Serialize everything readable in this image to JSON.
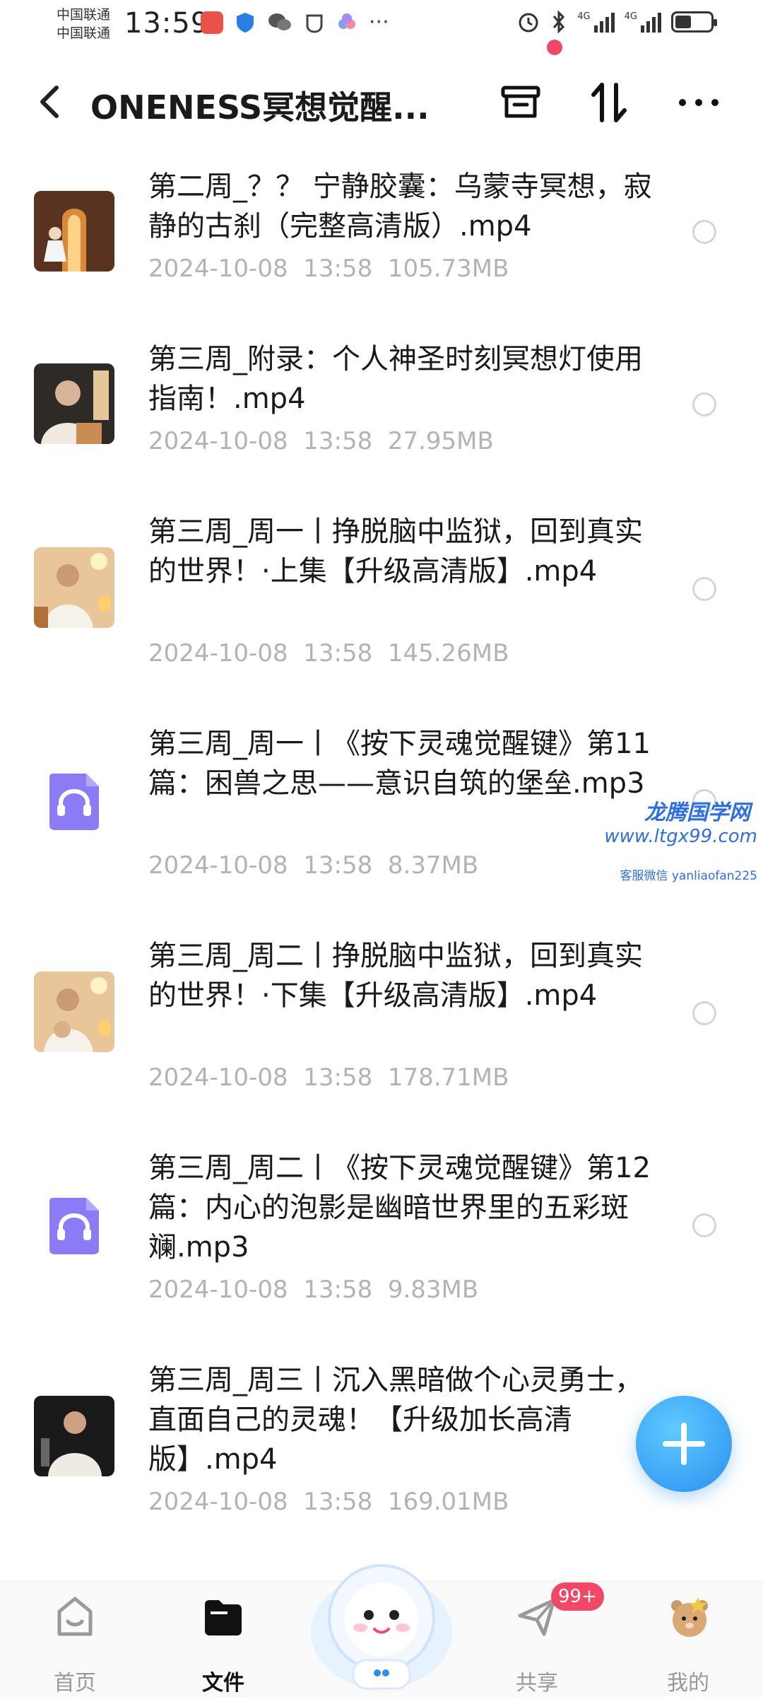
{
  "status_bar": {
    "carrier_1": "中国联通",
    "carrier_2": "中国联通",
    "time": "13:59",
    "more": "···",
    "network_1": "4G",
    "network_2": "4G"
  },
  "header": {
    "title": "ONENESS冥想觉醒...",
    "notification_dot": true
  },
  "files": [
    {
      "title": "第二周_？？ 宁静胶囊：乌蒙寺冥想，寂静的古刹（完整高清版）.mp4",
      "date": "2024-10-08",
      "time": "13:58",
      "size": "105.73MB",
      "type": "video",
      "thumb": "temple"
    },
    {
      "title": "第三周_附录：个人神圣时刻冥想灯使用指南！.mp4",
      "date": "2024-10-08",
      "time": "13:58",
      "size": "27.95MB",
      "type": "video",
      "thumb": "man-lamp"
    },
    {
      "title": "第三周_周一丨挣脱脑中监狱，回到真实的世界！·上集【升级高清版】.mp4",
      "date": "2024-10-08",
      "time": "13:58",
      "size": "145.26MB",
      "type": "video",
      "thumb": "man-candles"
    },
    {
      "title": "第三周_周一丨《按下灵魂觉醒键》第11篇：困兽之思——意识自筑的堡垒.mp3",
      "date": "2024-10-08",
      "time": "13:58",
      "size": "8.37MB",
      "type": "audio",
      "thumb": "headphones"
    },
    {
      "title": "第三周_周二丨挣脱脑中监狱，回到真实的世界！·下集【升级高清版】.mp4",
      "date": "2024-10-08",
      "time": "13:58",
      "size": "178.71MB",
      "type": "video",
      "thumb": "man-candles"
    },
    {
      "title": "第三周_周二丨《按下灵魂觉醒键》第12篇：内心的泡影是幽暗世界里的五彩斑斓.mp3",
      "date": "2024-10-08",
      "time": "13:58",
      "size": "9.83MB",
      "type": "audio",
      "thumb": "headphones"
    },
    {
      "title": "第三周_周三丨沉入黑暗做个心灵勇士，直面自己的灵魂！【升级加长高清版】.mp4",
      "date": "2024-10-08",
      "time": "13:58",
      "size": "169.01MB",
      "type": "video",
      "thumb": "man-dark"
    }
  ],
  "watermark": {
    "line1": "龙腾国学网",
    "line2": "www.ltgx99.com",
    "line3": "客服微信 yanliaofan225"
  },
  "bottom_nav": {
    "items": [
      {
        "label": "首页",
        "icon": "home-icon",
        "active": false
      },
      {
        "label": "文件",
        "icon": "folder-icon",
        "active": true
      },
      {
        "label": "共享",
        "icon": "share-icon",
        "active": false
      },
      {
        "label": "我的",
        "icon": "profile-icon",
        "active": false
      }
    ],
    "share_badge": "99+"
  },
  "colors": {
    "accent_blue": "#2b8ef0",
    "badge_red": "#f04866",
    "meta_gray": "#b0b3ba",
    "audio_purple": "#8b7cf6"
  }
}
